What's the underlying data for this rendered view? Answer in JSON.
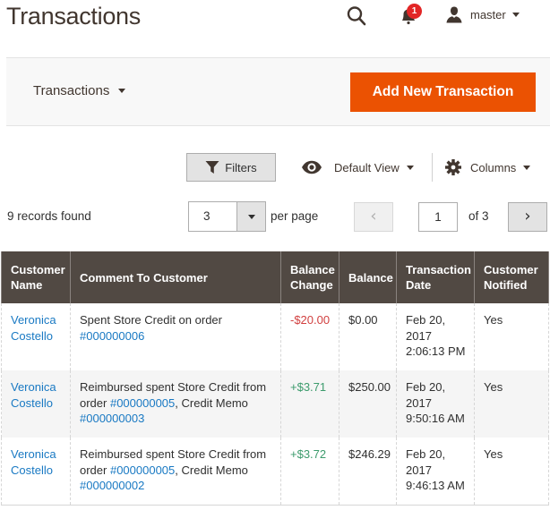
{
  "header": {
    "title": "Transactions",
    "notifications_count": "1",
    "user_name": "master"
  },
  "actions_bar": {
    "switcher_label": "Transactions",
    "add_button_label": "Add New Transaction"
  },
  "toolbar": {
    "filters_label": "Filters",
    "view_label": "Default View",
    "columns_label": "Columns"
  },
  "pager": {
    "records_found": "9 records found",
    "per_page_value": "3",
    "per_page_label": "per page",
    "current_page": "1",
    "total_pages_label": "of 3"
  },
  "grid": {
    "columns": [
      "Customer Name",
      "Comment To Customer",
      "Balance Change",
      "Balance",
      "Transaction Date",
      "Customer Notified"
    ],
    "rows": [
      {
        "customer_name": "Veronica Costello",
        "comment_text": "Spent Store Credit on order ",
        "comment_link1": "#000000006",
        "comment_mid": "",
        "comment_link2": "",
        "balance_change": "-$20.00",
        "balance": "$0.00",
        "date_line1": "Feb 20, 2017",
        "date_line2": "2:06:13 PM",
        "notified": "Yes"
      },
      {
        "customer_name": "Veronica Costello",
        "comment_text": "Reimbursed spent Store Credit from order ",
        "comment_link1": "#000000005",
        "comment_mid": ", Credit Memo ",
        "comment_link2": "#000000003",
        "balance_change": "+$3.71",
        "balance": "$250.00",
        "date_line1": "Feb 20, 2017",
        "date_line2": "9:50:16 AM",
        "notified": "Yes"
      },
      {
        "customer_name": "Veronica Costello",
        "comment_text": "Reimbursed spent Store Credit from order ",
        "comment_link1": "#000000005",
        "comment_mid": ", Credit Memo ",
        "comment_link2": "#000000002",
        "balance_change": "+$3.72",
        "balance": "$246.29",
        "date_line1": "Feb 20, 2017",
        "date_line2": "9:46:13 AM",
        "notified": "Yes"
      }
    ]
  }
}
